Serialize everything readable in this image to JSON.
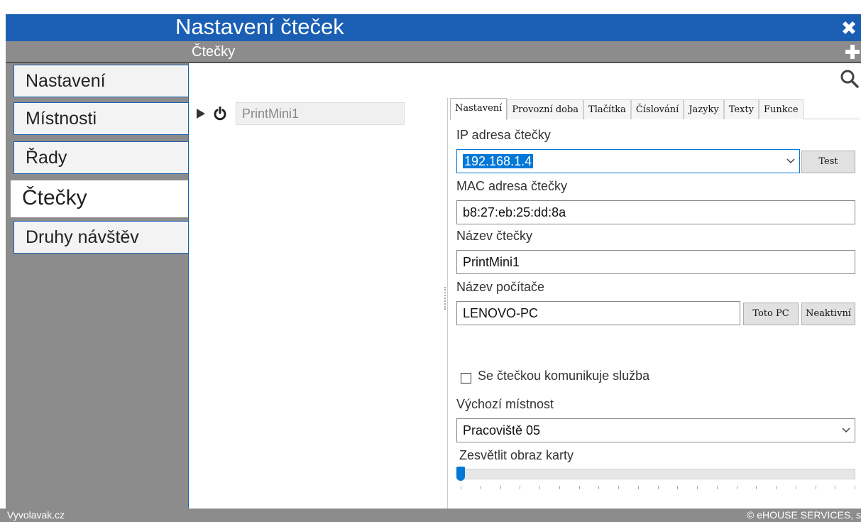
{
  "window": {
    "title": "Nastavení čteček"
  },
  "subheader": {
    "title": "Čtečky"
  },
  "sidebar": {
    "items": [
      {
        "label": "Nastavení"
      },
      {
        "label": "Místnosti"
      },
      {
        "label": "Řady"
      },
      {
        "label": "Čtečky",
        "active": true
      },
      {
        "label": "Druhy návštěv"
      }
    ]
  },
  "tree": {
    "reader_name": "PrintMini1"
  },
  "tabs": [
    "Nastavení",
    "Provozní doba",
    "Tlačítka",
    "Číslování",
    "Jazyky",
    "Texty",
    "Funkce"
  ],
  "form": {
    "ip_label": "IP adresa čtečky",
    "ip_value": "192.168.1.4",
    "test_button": "Test",
    "mac_label": "MAC adresa čtečky",
    "mac_value": "b8:27:eb:25:dd:8a",
    "name_label": "Název čtečky",
    "name_value": "PrintMini1",
    "pc_label": "Název počítače",
    "pc_value": "LENOVO-PC",
    "this_pc_button": "Toto PC",
    "inactive_button": "Neaktivní",
    "service_checkbox_label": "Se čtečkou komunikuje služba",
    "service_checked": false,
    "room_label": "Výchozí místnost",
    "room_value": "Pracoviště 05",
    "brighten_label": "Zesvětlit obraz karty",
    "brighten_value": 0
  },
  "footer": {
    "left": "Vyvolavak.cz",
    "right": "© eHOUSE SERVICES, s"
  },
  "colors": {
    "accent": "#1a5fb4",
    "chrome_gray": "#8c8c8c",
    "selection": "#0078d7"
  }
}
